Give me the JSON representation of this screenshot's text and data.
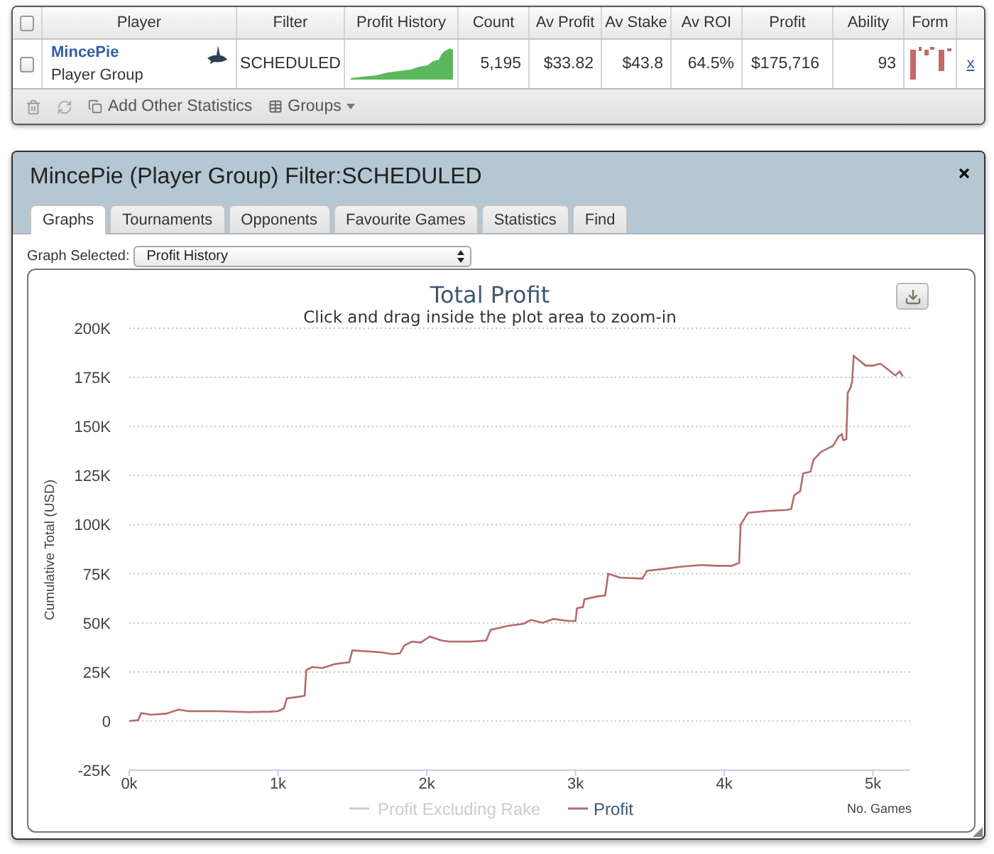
{
  "stats_table": {
    "select_all": {
      "checked": false
    },
    "columns": [
      "Player",
      "Filter",
      "Profit History",
      "Count",
      "Av Profit",
      "Av Stake",
      "Av ROI",
      "Profit",
      "Ability",
      "Form"
    ],
    "rows": [
      {
        "checked": false,
        "player": "MincePie",
        "player_type": "Player Group",
        "filter": "SCHEDULED",
        "count": "5,195",
        "av_profit": "$33.82",
        "av_stake": "$43.8",
        "av_roi": "64.5%",
        "profit": "$175,716",
        "ability": "93",
        "remove_link": "x"
      }
    ],
    "toolbar": [
      {
        "kind": "delete"
      },
      {
        "kind": "refresh"
      },
      {
        "kind": "add",
        "label": "Add Other Statistics"
      },
      {
        "kind": "groups",
        "label": "Groups"
      }
    ]
  },
  "dialog": {
    "title": "MincePie (Player Group) Filter:SCHEDULED",
    "tabs": [
      {
        "label": "Graphs",
        "selected": true
      },
      {
        "label": "Tournaments",
        "selected": false
      },
      {
        "label": "Opponents",
        "selected": false
      },
      {
        "label": "Favourite Games",
        "selected": false
      },
      {
        "label": "Statistics",
        "selected": false
      },
      {
        "label": "Find",
        "selected": false
      }
    ],
    "graph_selector": {
      "label": "Graph Selected:",
      "value": "Profit History"
    },
    "chart": {
      "subtitle": "Click and drag inside the plot area to zoom-in",
      "legend": [
        {
          "label": "Profit Excluding Rake",
          "visible": false
        },
        {
          "label": "Profit",
          "visible": true
        }
      ],
      "chart_data": {
        "type": "line",
        "title": "Total Profit",
        "xlabel": "No. Games",
        "ylabel": "Cumulative Total (USD)",
        "grid": true,
        "xlim": [
          0,
          5250
        ],
        "ylim": [
          -25000,
          200000
        ],
        "xticks": [
          {
            "value": 0,
            "label": "0k"
          },
          {
            "value": 1000,
            "label": "1k"
          },
          {
            "value": 2000,
            "label": "2k"
          },
          {
            "value": 3000,
            "label": "3k"
          },
          {
            "value": 4000,
            "label": "4k"
          },
          {
            "value": 5000,
            "label": "5k"
          }
        ],
        "yticks": [
          {
            "value": -25000,
            "label": "-25K"
          },
          {
            "value": 0,
            "label": "0"
          },
          {
            "value": 25000,
            "label": "25K"
          },
          {
            "value": 50000,
            "label": "50K"
          },
          {
            "value": 75000,
            "label": "75K"
          },
          {
            "value": 100000,
            "label": "100K"
          },
          {
            "value": 125000,
            "label": "125K"
          },
          {
            "value": 150000,
            "label": "150K"
          },
          {
            "value": 175000,
            "label": "175K"
          },
          {
            "value": 200000,
            "label": "200K"
          }
        ],
        "x": [
          0,
          60,
          80,
          150,
          250,
          330,
          400,
          600,
          800,
          950,
          1000,
          1040,
          1060,
          1150,
          1180,
          1190,
          1230,
          1300,
          1380,
          1480,
          1500,
          1600,
          1700,
          1770,
          1820,
          1850,
          1900,
          1960,
          2020,
          2100,
          2150,
          2300,
          2400,
          2430,
          2550,
          2650,
          2700,
          2780,
          2850,
          2950,
          3000,
          3010,
          3050,
          3060,
          3150,
          3200,
          3220,
          3300,
          3450,
          3480,
          3600,
          3700,
          3850,
          3950,
          4050,
          4080,
          4100,
          4110,
          4160,
          4300,
          4420,
          4450,
          4470,
          4510,
          4530,
          4580,
          4600,
          4650,
          4700,
          4730,
          4770,
          4790,
          4800,
          4820,
          4830,
          4850,
          4860,
          4870,
          4950,
          5000,
          5050,
          5100,
          5150,
          5180,
          5200
        ],
        "values": [
          0,
          500,
          4000,
          3200,
          3800,
          5800,
          5000,
          5000,
          4600,
          4800,
          5000,
          6500,
          11500,
          12500,
          13000,
          26000,
          27500,
          27000,
          29000,
          30000,
          36000,
          35500,
          35000,
          34000,
          34500,
          38500,
          40500,
          40000,
          43000,
          41000,
          40500,
          40500,
          41000,
          46500,
          48500,
          49500,
          51500,
          50000,
          52000,
          51000,
          51000,
          57500,
          58000,
          62000,
          63500,
          64000,
          75000,
          73000,
          72500,
          76500,
          77500,
          78500,
          79500,
          79000,
          79000,
          80000,
          80500,
          100000,
          106000,
          107000,
          107500,
          108000,
          115000,
          117000,
          126000,
          127000,
          133000,
          137000,
          139000,
          140000,
          145000,
          146000,
          143000,
          143500,
          167000,
          170000,
          173000,
          186000,
          181000,
          181000,
          182000,
          179000,
          176000,
          178000,
          175500
        ]
      }
    }
  }
}
